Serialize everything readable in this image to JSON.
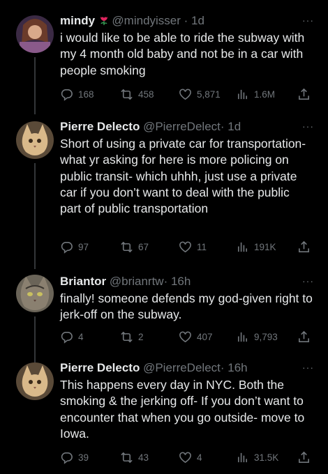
{
  "tweets": [
    {
      "name": "mindy",
      "handle": "@mindyisser",
      "time": "· 1d",
      "text": "i would like to be able to ride the subway with my 4 month old baby and not be in a car with people smoking",
      "replies": "168",
      "retweets": "458",
      "likes": "5,871",
      "views": "1.6M"
    },
    {
      "name": "Pierre Delecto",
      "handle": "@PierreDelect",
      "time": "· 1d",
      "text": "Short of using a private car for transportation- what yr asking for here is more policing on public transit- which uhhh, just use a private car if you don’t want to deal with the public part of public transportation",
      "replies": "97",
      "retweets": "67",
      "likes": "11",
      "views": "191K"
    },
    {
      "name": "Briantor",
      "handle": "@brianrtw",
      "time": "· 16h",
      "text": "finally! someone defends my god-given right to jerk-off on the subway.",
      "replies": "4",
      "retweets": "2",
      "likes": "407",
      "views": "9,793"
    },
    {
      "name": "Pierre Delecto",
      "handle": "@PierreDelect",
      "time": "· 16h",
      "text": "This happens every day in NYC. Both the smoking & the jerking off- If you don’t want to encounter that when you go outside- move to Iowa.",
      "replies": "39",
      "retweets": "43",
      "likes": "4",
      "views": "31.5K"
    }
  ]
}
